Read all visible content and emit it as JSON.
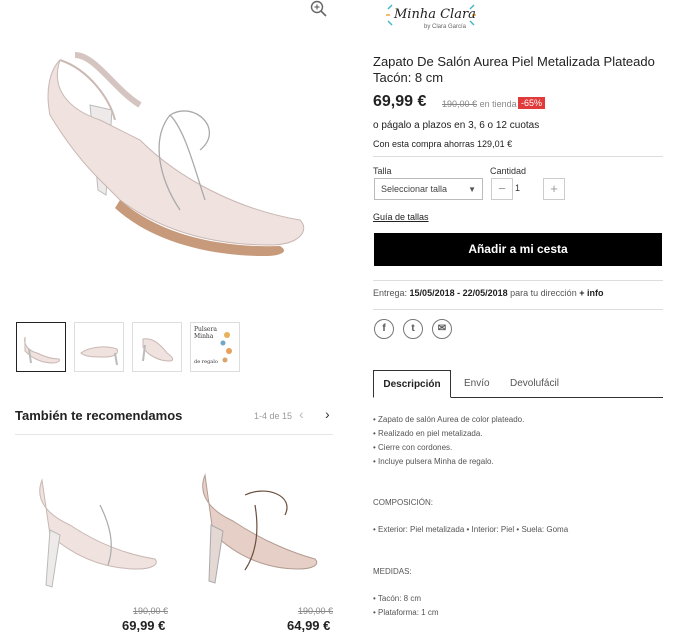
{
  "logo": {
    "name": "Minha Clara",
    "sub": "by Clara García"
  },
  "product": {
    "title": "Zapato De Salón Aurea Piel Metalizada Plateado Tacón: 8 cm",
    "price": "69,99 €",
    "old_price": "190,00 €",
    "old_price_suffix": "en tienda",
    "discount": "-65%",
    "plazos": "o págalo a plazos en 3, 6 o 12 cuotas",
    "ahorro": "Con esta compra ahorras 129,01 €"
  },
  "form": {
    "talla_label": "Talla",
    "talla_placeholder": "Seleccionar talla",
    "cantidad_label": "Cantidad",
    "minus": "−",
    "quantity": "1",
    "plus": "+",
    "guia": "Guía de tallas",
    "cart_button": "Añadir a mi cesta"
  },
  "delivery": {
    "label": "Entrega:",
    "dates": "15/05/2018 - 22/05/2018",
    "suffix": "para tu dirección",
    "info": "+ info"
  },
  "social": {
    "facebook": "f",
    "twitter": "t",
    "email": "✉"
  },
  "tabs": [
    {
      "label": "Descripción"
    },
    {
      "label": "Envío"
    },
    {
      "label": "Devolufácil"
    }
  ],
  "description": {
    "bullets": [
      "• Zapato de salón Aurea de color plateado.",
      "• Realizado en piel metalizada.",
      "• Cierre con cordones.",
      "• Incluye pulsera Minha de regalo."
    ],
    "composicion_title": "COMPOSICIÓN:",
    "composicion": "• Exterior: Piel metalizada • Interior: Piel • Suela: Goma",
    "medidas_title": "MEDIDAS:",
    "medidas": [
      "• Tacón: 8 cm",
      "• Plataforma: 1 cm"
    ]
  },
  "thumbnails": {
    "bracelet_text_1": "Pulsera",
    "bracelet_text_2": "Minha",
    "bracelet_text_3": "de regalo"
  },
  "recommendations": {
    "title": "También te recomendamos",
    "count": "1-4 de 15",
    "prev": "‹",
    "next": "›",
    "items": [
      {
        "old_price": "190,00 €",
        "price": "69,99 €"
      },
      {
        "old_price": "190,00 €",
        "price": "64,99 €"
      }
    ]
  },
  "colors": {
    "accent": "#000000",
    "discount": "#e03a3a"
  },
  "icons": {
    "zoom": "zoom-in-icon"
  }
}
